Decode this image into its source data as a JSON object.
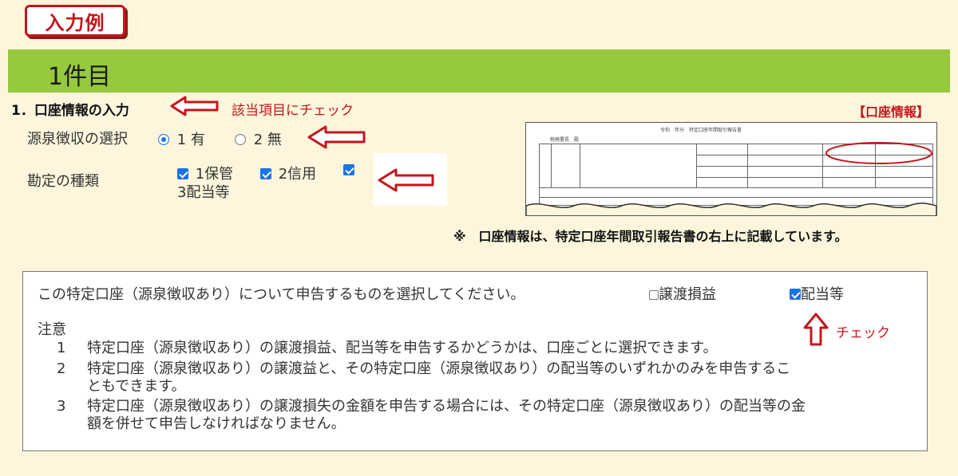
{
  "badge": {
    "label": "入力例"
  },
  "header": {
    "title": "1件目"
  },
  "section": {
    "title": "1．口座情報の入力",
    "hint": "該当項目にチェック",
    "report_tag": "【口座情報】"
  },
  "withholding": {
    "label": "源泉徴収の選択",
    "options": [
      {
        "label": "1 有",
        "selected": true
      },
      {
        "label": "2 無",
        "selected": false
      }
    ]
  },
  "account_type": {
    "label": "勘定の種類",
    "options": [
      {
        "label": "1保管",
        "checked": true
      },
      {
        "label": "2信用",
        "checked": true
      },
      {
        "label": "3配当等",
        "checked": true
      }
    ]
  },
  "report_thumb": {
    "title": "令和　年分　特定口座年間取引報告書",
    "header": "税務署長　殿"
  },
  "footnote": "※　口座情報は、特定口座年間取引報告書の右上に記載しています。",
  "notice": {
    "question": "この特定口座（源泉徴収あり）について申告するものを選択してください。",
    "options": [
      {
        "label": "譲渡損益",
        "checked": false
      },
      {
        "label": "配当等",
        "checked": true
      }
    ],
    "check_hint": "チェック",
    "heading": "注意",
    "items": [
      {
        "num": "1",
        "text": "特定口座（源泉徴収あり）の譲渡損益、配当等を申告するかどうかは、口座ごとに選択できます。"
      },
      {
        "num": "2",
        "line1": "特定口座（源泉徴収あり）の譲渡益と、その特定口座（源泉徴収あり）の配当等のいずれかのみを申告するこ",
        "line2": "ともできます。"
      },
      {
        "num": "3",
        "line1": "特定口座（源泉徴収あり）の譲渡損失の金額を申告する場合には、その特定口座（源泉徴収あり）の配当等の金",
        "line2": "額を併せて申告しなければなりません。"
      }
    ]
  },
  "colors": {
    "accent_red": "#c4161c",
    "header_green": "#97c93d",
    "checkbox_blue": "#1a73e8",
    "page_bg": "#fdf6dd"
  }
}
